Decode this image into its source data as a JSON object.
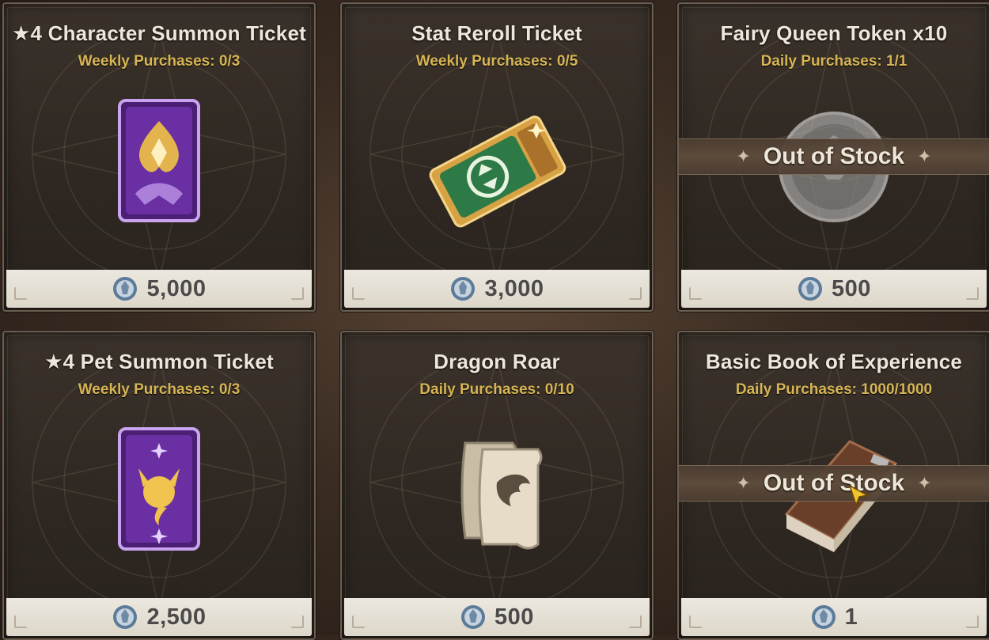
{
  "currency": {
    "icon": "silver-crest-coin-icon"
  },
  "colors": {
    "limit_text": "#d7b554",
    "card_bg": "#3a322b",
    "price_bar": "#e6e1d6"
  },
  "cards": [
    {
      "title": "★4 Character Summon Ticket",
      "limit": "Weekly Purchases: 0/3",
      "price": "5,000",
      "icon": "purple-summon-card-icon",
      "out_of_stock": false
    },
    {
      "title": "Stat Reroll Ticket",
      "limit": "Weekly Purchases: 0/5",
      "price": "3,000",
      "icon": "green-reroll-ticket-icon",
      "out_of_stock": false
    },
    {
      "title": "Fairy Queen Token x10",
      "limit": "Daily Purchases: 1/1",
      "price": "500",
      "icon": "silver-fairy-coin-icon",
      "out_of_stock": true,
      "oos_label": "Out of Stock"
    },
    {
      "title": "★4 Pet Summon Ticket",
      "limit": "Weekly Purchases: 0/3",
      "price": "2,500",
      "icon": "purple-pet-summon-card-icon",
      "out_of_stock": false
    },
    {
      "title": "Dragon Roar",
      "limit": "Daily Purchases: 0/10",
      "price": "500",
      "icon": "dragon-scroll-icon",
      "out_of_stock": false
    },
    {
      "title": "Basic Book of Experience",
      "limit": "Daily Purchases: 1000/1000",
      "price": "1",
      "icon": "experience-book-icon",
      "out_of_stock": true,
      "oos_label": "Out of Stock"
    }
  ]
}
